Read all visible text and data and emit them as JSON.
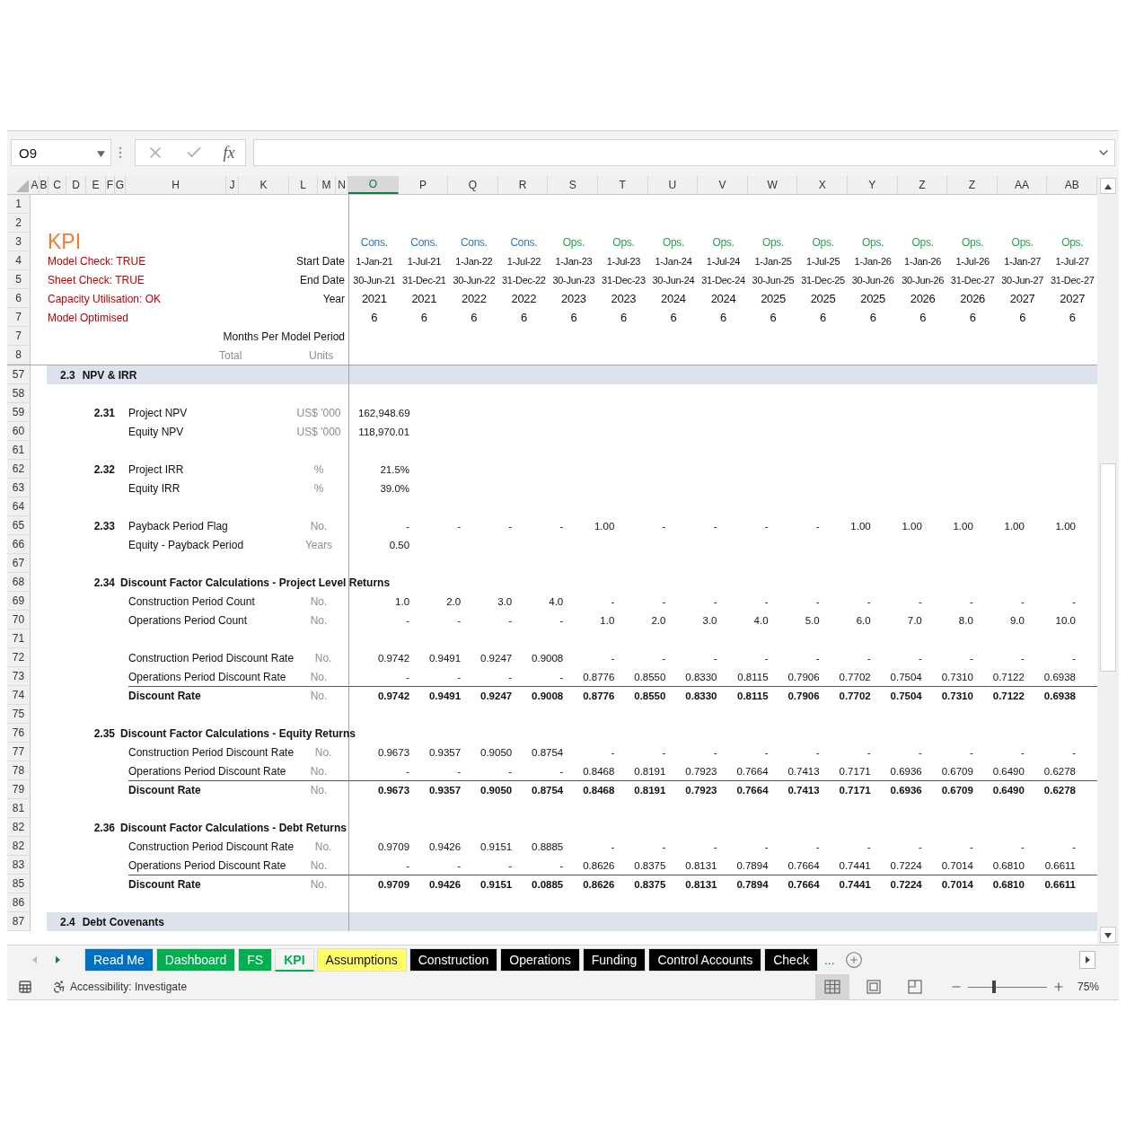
{
  "name_box": "O9",
  "function_label": "fx",
  "column_headers": [
    {
      "label": "A",
      "selected": false
    },
    {
      "label": "B",
      "selected": false
    },
    {
      "label": "C",
      "selected": false
    },
    {
      "label": "D",
      "selected": false
    },
    {
      "label": "E",
      "selected": false
    },
    {
      "label": "F",
      "selected": false
    },
    {
      "label": "G",
      "selected": false
    },
    {
      "label": "H",
      "selected": false
    },
    {
      "label": "J",
      "selected": false
    },
    {
      "label": "K",
      "selected": false
    },
    {
      "label": "L",
      "selected": false
    },
    {
      "label": "M",
      "selected": false
    },
    {
      "label": "N",
      "selected": false
    },
    {
      "label": "O",
      "selected": true
    },
    {
      "label": "P",
      "selected": false
    },
    {
      "label": "Q",
      "selected": false
    },
    {
      "label": "R",
      "selected": false
    },
    {
      "label": "S",
      "selected": false
    },
    {
      "label": "T",
      "selected": false
    },
    {
      "label": "U",
      "selected": false
    },
    {
      "label": "V",
      "selected": false
    },
    {
      "label": "W",
      "selected": false
    },
    {
      "label": "X",
      "selected": false
    },
    {
      "label": "Y",
      "selected": false
    },
    {
      "label": "Z",
      "selected": false
    },
    {
      "label": "Z",
      "selected": false
    },
    {
      "label": "AA",
      "selected": false
    },
    {
      "label": "AB",
      "selected": false
    }
  ],
  "periods": [
    {
      "phase": "Cons.",
      "kind": "construction",
      "start": "1-Jan-21",
      "end": "30-Jun-21",
      "year": "2021",
      "months": "6"
    },
    {
      "phase": "Cons.",
      "kind": "construction",
      "start": "1-Jul-21",
      "end": "31-Dec-21",
      "year": "2021",
      "months": "6"
    },
    {
      "phase": "Cons.",
      "kind": "construction",
      "start": "1-Jan-22",
      "end": "30-Jun-22",
      "year": "2022",
      "months": "6"
    },
    {
      "phase": "Cons.",
      "kind": "construction",
      "start": "1-Jul-22",
      "end": "31-Dec-22",
      "year": "2022",
      "months": "6"
    },
    {
      "phase": "Ops.",
      "kind": "operations",
      "start": "1-Jan-23",
      "end": "30-Jun-23",
      "year": "2023",
      "months": "6"
    },
    {
      "phase": "Ops.",
      "kind": "operations",
      "start": "1-Jul-23",
      "end": "31-Dec-23",
      "year": "2023",
      "months": "6"
    },
    {
      "phase": "Ops.",
      "kind": "operations",
      "start": "1-Jan-24",
      "end": "30-Jun-24",
      "year": "2024",
      "months": "6"
    },
    {
      "phase": "Ops.",
      "kind": "operations",
      "start": "1-Jul-24",
      "end": "31-Dec-24",
      "year": "2024",
      "months": "6"
    },
    {
      "phase": "Ops.",
      "kind": "operations",
      "start": "1-Jan-25",
      "end": "30-Jun-25",
      "year": "2025",
      "months": "6"
    },
    {
      "phase": "Ops.",
      "kind": "operations",
      "start": "1-Jul-25",
      "end": "31-Dec-25",
      "year": "2025",
      "months": "6"
    },
    {
      "phase": "Ops.",
      "kind": "operations",
      "start": "1-Jan-26",
      "end": "30-Jun-26",
      "year": "2025",
      "months": "6"
    },
    {
      "phase": "Ops.",
      "kind": "operations",
      "start": "1-Jan-26",
      "end": "30-Jun-26",
      "year": "2026",
      "months": "6"
    },
    {
      "phase": "Ops.",
      "kind": "operations",
      "start": "1-Jul-26",
      "end": "31-Dec-27",
      "year": "2026",
      "months": "6"
    },
    {
      "phase": "Ops.",
      "kind": "operations",
      "start": "1-Jan-27",
      "end": "30-Jun-27",
      "year": "2027",
      "months": "6"
    },
    {
      "phase": "Ops.",
      "kind": "operations",
      "start": "1-Jul-27",
      "end": "31-Dec-27",
      "year": "2027",
      "months": "6"
    }
  ],
  "header_rows": [
    {
      "row": "1",
      "kind": "blank"
    },
    {
      "row": "2",
      "kind": "blank"
    },
    {
      "row": "3",
      "kind": "phase",
      "title": "KPI"
    },
    {
      "row": "4",
      "kind": "start",
      "note": "Model Check: TRUE",
      "label": "Start Date"
    },
    {
      "row": "5",
      "kind": "end",
      "note": "Sheet Check: TRUE",
      "label": "End Date"
    },
    {
      "row": "6",
      "kind": "year",
      "note": "Capacity Utilisation: OK",
      "label": "Year"
    },
    {
      "row": "7",
      "kind": "months",
      "note": "Model Optimised"
    },
    {
      "row": "7",
      "kind": "label_only",
      "label": "Months Per Model Period"
    },
    {
      "row": "8",
      "kind": "totals",
      "total": "Total",
      "units": "Units"
    }
  ],
  "rows": [
    {
      "row": "57",
      "kind": "section",
      "code": "2.3",
      "label": "NPV & IRR"
    },
    {
      "row": "58",
      "kind": "blank"
    },
    {
      "row": "59",
      "kind": "item",
      "code": "2.31",
      "label": "Project NPV",
      "unit": "US$ '000",
      "values": [
        "162,948.69"
      ]
    },
    {
      "row": "60",
      "kind": "item",
      "label": "Equity NPV",
      "unit": "US$ '000",
      "values": [
        "118,970.01"
      ]
    },
    {
      "row": "61",
      "kind": "blank"
    },
    {
      "row": "62",
      "kind": "item",
      "code": "2.32",
      "label": "Project IRR",
      "unit": "%",
      "values": [
        "21.5%"
      ]
    },
    {
      "row": "63",
      "kind": "item",
      "label": "Equity IRR",
      "unit": "%",
      "values": [
        "39.0%"
      ]
    },
    {
      "row": "64",
      "kind": "blank"
    },
    {
      "row": "65",
      "kind": "item",
      "code": "2.33",
      "label": "Payback Period Flag",
      "unit": "No.",
      "values": [
        "-",
        "-",
        "-",
        "-",
        "1.00",
        "-",
        "-",
        "-",
        "-",
        "1.00",
        "1.00",
        "1.00",
        "1.00",
        "1.00"
      ]
    },
    {
      "row": "66",
      "kind": "item",
      "label": "Equity - Payback Period",
      "unit": "Years",
      "values": [
        "0.50"
      ]
    },
    {
      "row": "67",
      "kind": "blank"
    },
    {
      "row": "68",
      "kind": "subheading",
      "code": "2.34",
      "label": "Discount Factor Calculations - Project Level Returns"
    },
    {
      "row": "69",
      "kind": "item",
      "label": "Construction Period Count",
      "unit": "No.",
      "values": [
        "1.0",
        "2.0",
        "3.0",
        "4.0",
        "-",
        "-",
        "-",
        "-",
        "-",
        "-",
        "-",
        "-",
        "-",
        "-"
      ]
    },
    {
      "row": "70",
      "kind": "item",
      "label": "Operations Period Count",
      "unit": "No.",
      "values": [
        "-",
        "-",
        "-",
        "-",
        "1.0",
        "2.0",
        "3.0",
        "4.0",
        "5.0",
        "6.0",
        "7.0",
        "8.0",
        "9.0",
        "10.0"
      ]
    },
    {
      "row": "71",
      "kind": "blank"
    },
    {
      "row": "72",
      "kind": "item",
      "label": "Construction Period Discount Rate",
      "unit": "No.",
      "values": [
        "0.9742",
        "0.9491",
        "0.9247",
        "0.9008",
        "-",
        "-",
        "-",
        "-",
        "-",
        "-",
        "-",
        "-",
        "-",
        "-"
      ]
    },
    {
      "row": "73",
      "kind": "item",
      "label": "Operations Period Discount Rate",
      "unit": "No.",
      "values": [
        "-",
        "-",
        "-",
        "-",
        "0.8776",
        "0.8550",
        "0.8330",
        "0.8115",
        "0.7906",
        "0.7702",
        "0.7504",
        "0.7310",
        "0.7122",
        "0.6938"
      ]
    },
    {
      "row": "74",
      "kind": "total",
      "label": "Discount Rate",
      "unit": "No.",
      "values": [
        "0.9742",
        "0.9491",
        "0.9247",
        "0.9008",
        "0.8776",
        "0.8550",
        "0.8330",
        "0.8115",
        "0.7906",
        "0.7702",
        "0.7504",
        "0.7310",
        "0.7122",
        "0.6938"
      ]
    },
    {
      "row": "75",
      "kind": "blank"
    },
    {
      "row": "76",
      "kind": "subheading",
      "code": "2.35",
      "label": "Discount Factor Calculations - Equity Returns"
    },
    {
      "row": "77",
      "kind": "item",
      "label": "Construction Period Discount Rate",
      "unit": "No.",
      "values": [
        "0.9673",
        "0.9357",
        "0.9050",
        "0.8754",
        "-",
        "-",
        "-",
        "-",
        "-",
        "-",
        "-",
        "-",
        "-",
        "-"
      ]
    },
    {
      "row": "78",
      "kind": "item",
      "label": "Operations Period Discount Rate",
      "unit": "No.",
      "values": [
        "-",
        "-",
        "-",
        "-",
        "0.8468",
        "0.8191",
        "0.7923",
        "0.7664",
        "0.7413",
        "0.7171",
        "0.6936",
        "0.6709",
        "0.6490",
        "0.6278"
      ]
    },
    {
      "row": "79",
      "kind": "total",
      "label": "Discount Rate",
      "unit": "No.",
      "values": [
        "0.9673",
        "0.9357",
        "0.9050",
        "0.8754",
        "0.8468",
        "0.8191",
        "0.7923",
        "0.7664",
        "0.7413",
        "0.7171",
        "0.6936",
        "0.6709",
        "0.6490",
        "0.6278"
      ]
    },
    {
      "row": "81",
      "kind": "blank"
    },
    {
      "row": "82",
      "kind": "subheading",
      "code": "2.36",
      "label": "Discount Factor Calculations - Debt Returns"
    },
    {
      "row": "82",
      "kind": "item",
      "label": "Construction Period Discount Rate",
      "unit": "No.",
      "values": [
        "0.9709",
        "0.9426",
        "0.9151",
        "0.8885",
        "-",
        "-",
        "-",
        "-",
        "-",
        "-",
        "-",
        "-",
        "-",
        "-"
      ]
    },
    {
      "row": "83",
      "kind": "item",
      "label": "Operations Period Discount Rate",
      "unit": "No.",
      "values": [
        "-",
        "-",
        "-",
        "-",
        "0.8626",
        "0.8375",
        "0.8131",
        "0.7894",
        "0.7664",
        "0.7441",
        "0.7224",
        "0.7014",
        "0.6810",
        "0.6611"
      ]
    },
    {
      "row": "85",
      "kind": "total",
      "label": "Discount Rate",
      "unit": "No.",
      "values": [
        "0.9709",
        "0.9426",
        "0.9151",
        "0.0885",
        "0.8626",
        "0.8375",
        "0.8131",
        "0.7894",
        "0.7664",
        "0.7441",
        "0.7224",
        "0.7014",
        "0.6810",
        "0.6611"
      ]
    },
    {
      "row": "86",
      "kind": "blank"
    },
    {
      "row": "87",
      "kind": "section",
      "code": "2.4",
      "label": "Debt Covenants"
    }
  ],
  "tabs": [
    {
      "label": "Read Me",
      "color": "#0070c0",
      "selected": false
    },
    {
      "label": "Dashboard",
      "color": "#00b050",
      "selected": false
    },
    {
      "label": "FS",
      "color": "#00b050",
      "selected": false
    },
    {
      "label": "KPI",
      "color": "#00b050",
      "selected": true
    },
    {
      "label": "Assumptions",
      "color": "#ffff66",
      "selected": false
    },
    {
      "label": "Construction",
      "color": "#000000",
      "selected": false
    },
    {
      "label": "Operations",
      "color": "#000000",
      "selected": false
    },
    {
      "label": "Funding",
      "color": "#000000",
      "selected": false
    },
    {
      "label": "Control Accounts",
      "color": "#000000",
      "selected": false
    },
    {
      "label": "Check",
      "color": "#000000",
      "selected": false
    }
  ],
  "more_tabs": "...",
  "status_bar": {
    "accessibility": "Accessibility: Investigate",
    "views": [
      {
        "kind": "normal",
        "selected": true
      },
      {
        "kind": "page_layout",
        "selected": false
      },
      {
        "kind": "page_break",
        "selected": false
      }
    ],
    "zoom": {
      "level": 0.33,
      "reading": "75%"
    }
  }
}
